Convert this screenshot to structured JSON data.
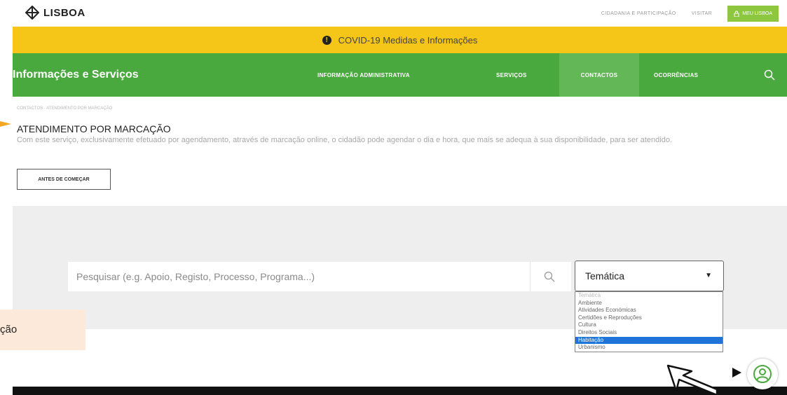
{
  "brand": {
    "name": "LISBOA"
  },
  "top_links": [
    "CIDADANIA E PARTICIPAÇÃO",
    "VISITAR",
    "MEU LISBOA"
  ],
  "covid_banner": {
    "text": "COVID-19 Medidas e Informações",
    "icon": "info-icon"
  },
  "nav": {
    "title": "Informações e Serviços",
    "items": [
      "INFORMAÇÃO ADMINISTRATIVA",
      "SERVIÇOS",
      "CONTACTOS",
      "OCORRÊNCIAS"
    ],
    "active": "CONTACTOS"
  },
  "breadcrumb": "CONTACTOS · ATENDIMENTO POR MARCAÇÃO",
  "page": {
    "title": "ATENDIMENTO POR MARCAÇÃO",
    "intro": "Com este serviço, exclusivamente efetuado por agendamento, através de marcação online, o cidadão pode agendar o dia e hora, que mais se adequa à sua disponibilidade, para ser atendido.",
    "button": "ANTES DE COMEÇAR"
  },
  "search": {
    "placeholder": "Pesquisar (e.g. Apoio, Registo, Processo, Programa...)"
  },
  "tematica": {
    "label": "Temática",
    "options": [
      "Temática",
      "Ambiente",
      "Atividades Económicas",
      "Certidões e Reproduções",
      "Cultura",
      "Direitos Sociais",
      "Habitação",
      "Urbanismo"
    ],
    "highlighted": "Habitação"
  },
  "callout": {
    "text": "ção"
  },
  "colors": {
    "green": "#4aa93e",
    "yellow": "#f5c518",
    "highlight": "#1e74d8",
    "light_green": "#8dc63f"
  }
}
